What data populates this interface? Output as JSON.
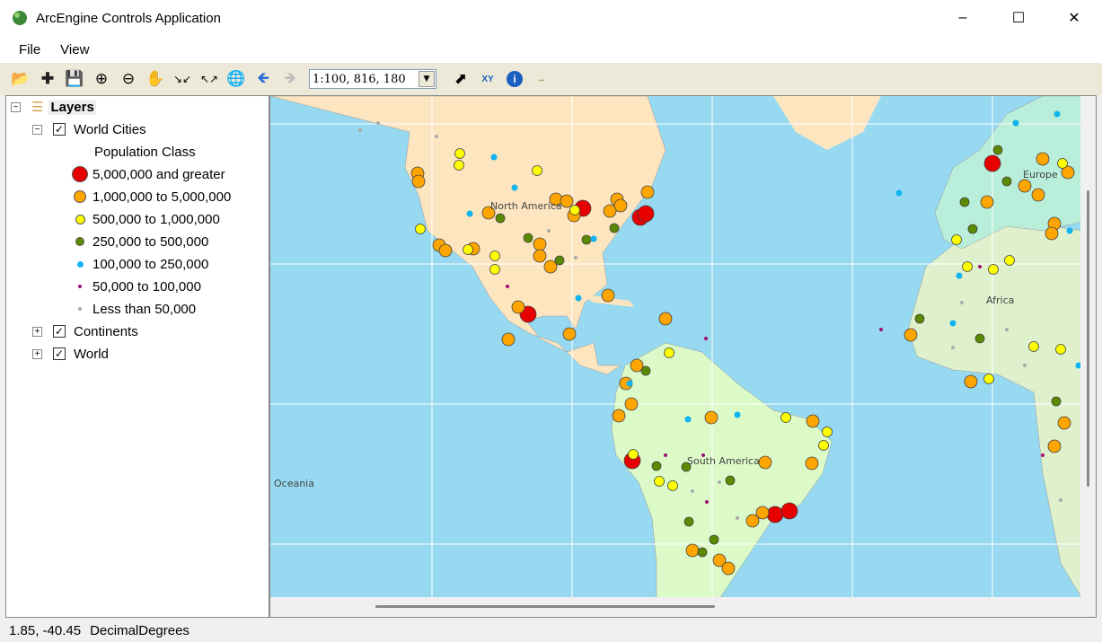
{
  "window": {
    "title": "ArcEngine Controls Application",
    "controls": [
      "minimize",
      "maximize",
      "close"
    ]
  },
  "menu": [
    "File",
    "View"
  ],
  "toolbar": {
    "tools": [
      "open-icon",
      "add-data-icon",
      "save-icon",
      "zoom-in-icon",
      "zoom-out-icon",
      "pan-icon",
      "fixed-zoom-in-icon",
      "fixed-zoom-out-icon",
      "full-extent-icon",
      "back-icon",
      "forward-icon"
    ],
    "scale": "1:100, 816, 180",
    "tools2": [
      "select-icon",
      "go-to-xy-icon",
      "identify-icon",
      "measure-icon"
    ]
  },
  "toc": {
    "root": "Layers",
    "layers": [
      {
        "name": "World Cities",
        "checked": true,
        "expanded": true,
        "legend_heading": "Population Class",
        "classes": [
          {
            "label": "5,000,000 and greater",
            "color": "#e60000"
          },
          {
            "label": "1,000,000 to 5,000,000",
            "color": "#ffa500"
          },
          {
            "label": "500,000 to 1,000,000",
            "color": "#ffff00"
          },
          {
            "label": "250,000 to 500,000",
            "color": "#5a8a00"
          },
          {
            "label": "100,000 to 250,000",
            "color": "#10b4f0"
          },
          {
            "label": "50,000 to 100,000",
            "color": "#a01070"
          },
          {
            "label": "Less than 50,000",
            "color": "#aaaaaa"
          }
        ]
      },
      {
        "name": "Continents",
        "checked": true,
        "expanded": false
      },
      {
        "name": "World",
        "checked": true,
        "expanded": false
      }
    ]
  },
  "map": {
    "labels": [
      "North America",
      "South America",
      "Europe",
      "Africa",
      "Oceania"
    ],
    "ocean_color": "#97d9f0"
  },
  "status": {
    "coords": "1.85, -40.45",
    "units": "DecimalDegrees"
  }
}
